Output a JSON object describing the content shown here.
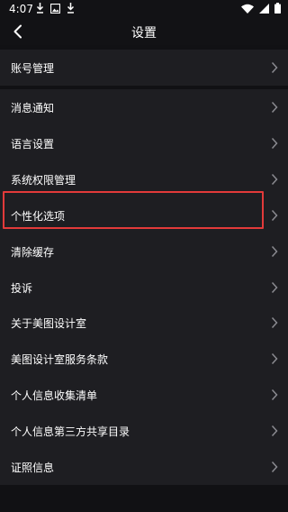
{
  "status_bar": {
    "time": "4:07",
    "notification_icons": [
      "download-icon",
      "photo-icon",
      "download-icon"
    ],
    "right_icons": [
      "wifi-icon",
      "signal-icon",
      "battery-icon"
    ]
  },
  "header": {
    "title": "设置",
    "back_icon": "back-arrow-icon"
  },
  "groups": [
    {
      "items": [
        {
          "label": "账号管理"
        }
      ]
    },
    {
      "items": [
        {
          "label": "消息通知"
        },
        {
          "label": "语言设置"
        },
        {
          "label": "系统权限管理"
        },
        {
          "label": "个性化选项"
        },
        {
          "label": "清除缓存"
        },
        {
          "label": "投诉"
        }
      ]
    },
    {
      "items": [
        {
          "label": "关于美图设计室"
        },
        {
          "label": "美图设计室服务条款"
        },
        {
          "label": "个人信息收集清单"
        },
        {
          "label": "个人信息第三方共享目录"
        },
        {
          "label": "证照信息"
        }
      ]
    }
  ],
  "highlighted_item": "个性化选项",
  "colors": {
    "background": "#111114",
    "row_background": "#1e1e22",
    "highlight_border": "#e23a3a",
    "chevron": "#8a8a90"
  }
}
